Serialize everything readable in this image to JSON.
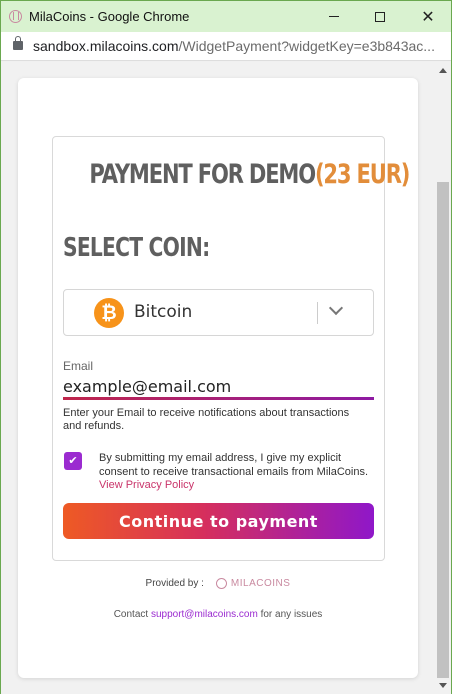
{
  "browser": {
    "title": "MilaCoins - Google Chrome",
    "url_host": "sandbox.milacoins.com",
    "url_path": "/WidgetPayment?widgetKey=e3b843ac..."
  },
  "payment": {
    "heading": "PAYMENT FOR DEMO",
    "amount": "(23 EUR)",
    "select_label": "SELECT COIN:",
    "coin_symbol": "₿",
    "coin_name": "Bitcoin"
  },
  "email": {
    "label": "Email",
    "value": "example@email.com",
    "hint": "Enter your Email to receive notifications about transactions and refunds."
  },
  "consent": {
    "checked_glyph": "✔",
    "text": "By submitting my email address, I give my explicit consent to receive transactional emails from MilaCoins.",
    "link": "View Privacy Policy"
  },
  "actions": {
    "continue": "Continue to payment"
  },
  "footer": {
    "provided_by": "Provided by :",
    "logo_text": "MILACOINS",
    "contact_prefix": "Contact",
    "contact_email": "support@milacoins.com",
    "contact_suffix": "for any issues"
  },
  "colors": {
    "amount": "#e28d3a",
    "accent": "#9b2bd0",
    "button_gradient_start": "#ee5a24",
    "button_gradient_end": "#8f17c9"
  }
}
